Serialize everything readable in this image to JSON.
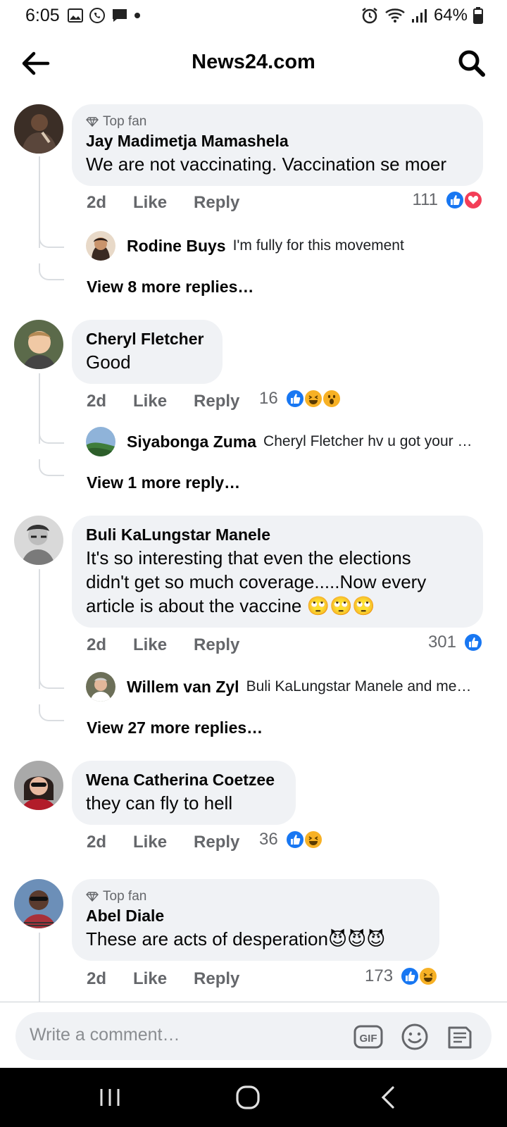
{
  "status_bar": {
    "time": "6:05",
    "battery": "64%"
  },
  "header": {
    "title": "News24.com"
  },
  "comments": [
    {
      "top_fan": "Top fan",
      "author": "Jay Madimetja Mamashela",
      "text": "We are not vaccinating. Vaccination se moer",
      "time": "2d",
      "like": "Like",
      "reply": "Reply",
      "reaction_count": "111",
      "reply_preview": {
        "author": "Rodine Buys",
        "text": "I'm fully for this movement"
      },
      "more_replies": "View 8 more replies…"
    },
    {
      "author": "Cheryl Fletcher",
      "text": "Good",
      "time": "2d",
      "like": "Like",
      "reply": "Reply",
      "reaction_count": "16",
      "reply_preview": {
        "author": "Siyabonga Zuma",
        "text": "Cheryl Fletcher hv u got your …"
      },
      "more_replies": "View 1 more reply…"
    },
    {
      "author": "Buli KaLungstar Manele",
      "text_lines": [
        "It's so interesting that even the elections",
        "didn't get so much coverage.....Now every",
        "article is about the vaccine 🙄🙄🙄"
      ],
      "time": "2d",
      "like": "Like",
      "reply": "Reply",
      "reaction_count": "301",
      "reply_preview": {
        "author": "Willem van Zyl",
        "text": "Buli KaLungstar Manele and me…"
      },
      "more_replies": "View 27 more replies…"
    },
    {
      "author": "Wena Catherina Coetzee",
      "text": "they can fly to hell",
      "time": "2d",
      "like": "Like",
      "reply": "Reply",
      "reaction_count": "36"
    },
    {
      "top_fan": "Top fan",
      "author": "Abel Diale",
      "text": "These are acts of desperation😈😈😈",
      "time": "2d",
      "like": "Like",
      "reply": "Reply",
      "reaction_count": "173"
    }
  ],
  "composer": {
    "placeholder": "Write a comment…",
    "gif_label": "GIF"
  },
  "colors": {
    "like_blue": "#1877f2",
    "love_red": "#f33e58",
    "haha_yellow": "#f7b125",
    "bubble_bg": "#f0f2f5"
  }
}
